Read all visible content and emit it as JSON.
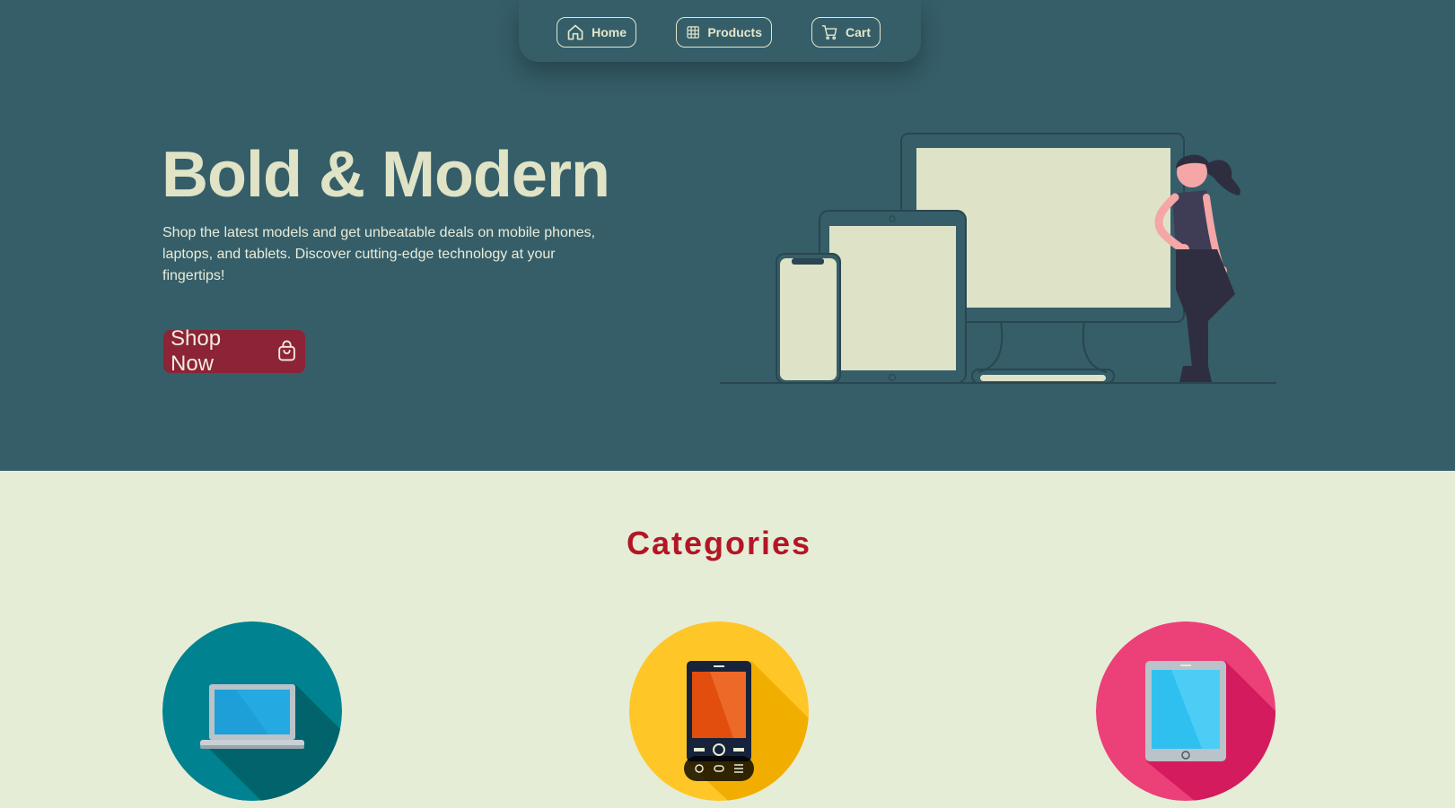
{
  "nav": {
    "home_label": "Home",
    "products_label": "Products",
    "cart_label": "Cart"
  },
  "hero": {
    "title": "Bold & Modern",
    "description": "Shop the latest models and get unbeatable deals on mobile phones, laptops, and tablets. Discover cutting-edge technology at your fingertips!",
    "cta_label": "Shop Now"
  },
  "categories": {
    "title": "Categories",
    "items": [
      {
        "icon": "laptop-icon",
        "color": "#008290"
      },
      {
        "icon": "mobile-phone-icon",
        "color": "#ffc628"
      },
      {
        "icon": "tablet-icon",
        "color": "#ec4078"
      }
    ]
  },
  "colors": {
    "hero_bg": "#355e69",
    "page_bg": "#e6edd6",
    "accent": "#8c2336",
    "heading_red": "#b31626",
    "cream": "#e0e3c5"
  }
}
